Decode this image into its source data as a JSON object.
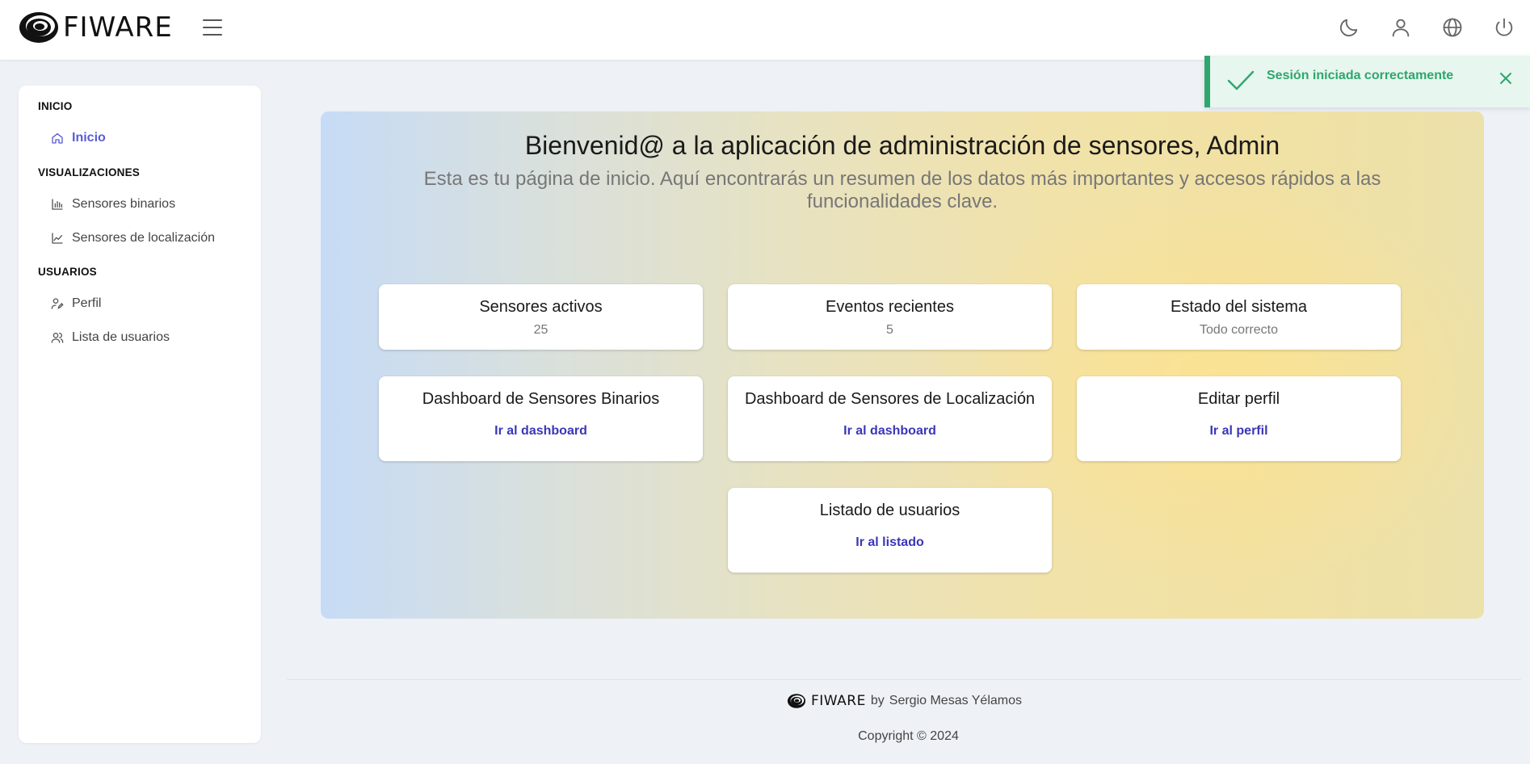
{
  "header": {
    "logo_text": "FIWARE",
    "icons": [
      "theme-moon-icon",
      "user-icon",
      "language-globe-icon",
      "power-icon"
    ]
  },
  "toast": {
    "message": "Sesión iniciada correctamente",
    "status_color": "#2fa66e"
  },
  "sidebar": {
    "sections": [
      {
        "title": "INICIO",
        "items": [
          {
            "label": "Inicio",
            "icon": "home-icon",
            "active": true
          }
        ]
      },
      {
        "title": "VISUALIZACIONES",
        "items": [
          {
            "label": "Sensores binarios",
            "icon": "bar-chart-icon"
          },
          {
            "label": "Sensores de localización",
            "icon": "line-chart-icon"
          }
        ]
      },
      {
        "title": "USUARIOS",
        "items": [
          {
            "label": "Perfil",
            "icon": "user-edit-icon"
          },
          {
            "label": "Lista de usuarios",
            "icon": "users-icon"
          }
        ]
      }
    ],
    "accent_color": "#5b5bd6"
  },
  "hero": {
    "title": "Bienvenid@ a la aplicación de administración de sensores, Admin",
    "subtitle": "Esta es tu página de inicio. Aquí encontrarás un resumen de los datos más importantes y accesos rápidos a las funcionalidades clave."
  },
  "stats": [
    {
      "title": "Sensores activos",
      "value": "25"
    },
    {
      "title": "Eventos recientes",
      "value": "5"
    },
    {
      "title": "Estado del sistema",
      "value": "Todo correcto"
    }
  ],
  "shortcuts": [
    {
      "title": "Dashboard de Sensores Binarios",
      "link": "Ir al dashboard"
    },
    {
      "title": "Dashboard de Sensores de Localización",
      "link": "Ir al dashboard"
    },
    {
      "title": "Editar perfil",
      "link": "Ir al perfil"
    },
    {
      "title": "Listado de usuarios",
      "link": "Ir al listado"
    }
  ],
  "footer": {
    "brand": "FIWARE",
    "by": "by",
    "author": "Sergio Mesas Yélamos",
    "copyright": "Copyright © 2024"
  },
  "colors": {
    "link": "#3a36b8",
    "background": "#eef1f6"
  }
}
